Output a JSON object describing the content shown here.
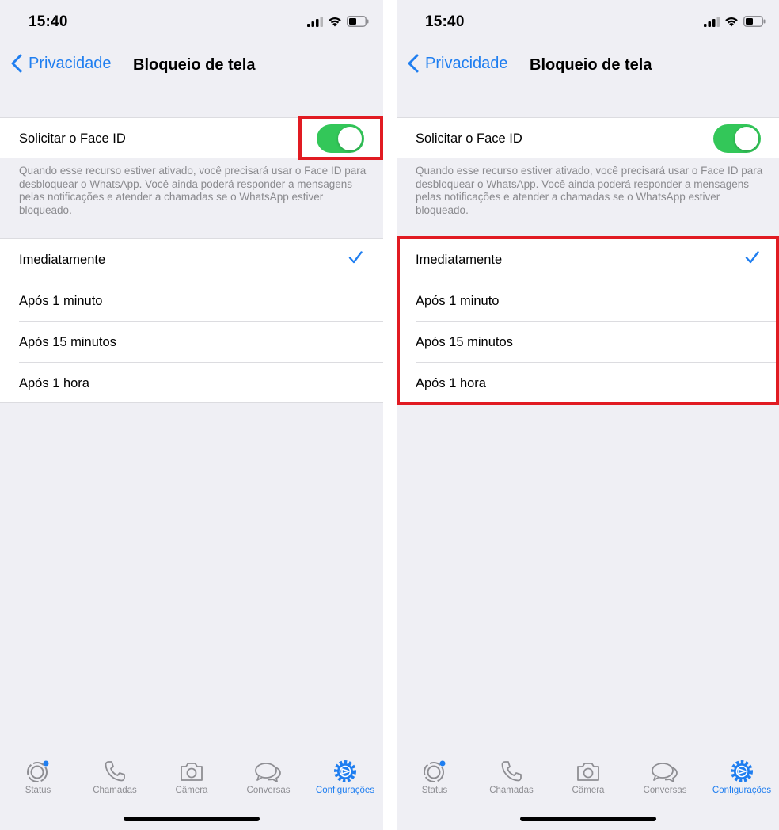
{
  "colors": {
    "accent": "#1f7ef0",
    "toggle_on": "#33c759",
    "highlight": "#e11b22",
    "background": "#efeff4"
  },
  "screens": [
    {
      "status": {
        "time": "15:40"
      },
      "nav": {
        "back_label": "Privacidade",
        "title": "Bloqueio de tela"
      },
      "face_id": {
        "label": "Solicitar o Face ID",
        "enabled": true
      },
      "note": "Quando esse recurso estiver ativado, você precisará usar o Face ID para desbloquear o WhatsApp. Você ainda poderá responder a mensagens pelas notificações e atender a chamadas se o WhatsApp estiver bloqueado.",
      "options": [
        {
          "label": "Imediatamente",
          "selected": true
        },
        {
          "label": "Após 1 minuto",
          "selected": false
        },
        {
          "label": "Após 15 minutos",
          "selected": false
        },
        {
          "label": "Após 1 hora",
          "selected": false
        }
      ],
      "highlight": "face-id-toggle",
      "tabs": [
        {
          "label": "Status",
          "icon": "status-icon",
          "active": false
        },
        {
          "label": "Chamadas",
          "icon": "phone-icon",
          "active": false
        },
        {
          "label": "Câmera",
          "icon": "camera-icon",
          "active": false
        },
        {
          "label": "Conversas",
          "icon": "chat-bubbles-icon",
          "active": false
        },
        {
          "label": "Configurações",
          "icon": "settings-gear-icon",
          "active": true
        }
      ]
    },
    {
      "status": {
        "time": "15:40"
      },
      "nav": {
        "back_label": "Privacidade",
        "title": "Bloqueio de tela"
      },
      "face_id": {
        "label": "Solicitar o Face ID",
        "enabled": true
      },
      "note": "Quando esse recurso estiver ativado, você precisará usar o Face ID para desbloquear o WhatsApp. Você ainda poderá responder a mensagens pelas notificações e atender a chamadas se o WhatsApp estiver bloqueado.",
      "options": [
        {
          "label": "Imediatamente",
          "selected": true
        },
        {
          "label": "Após 1 minuto",
          "selected": false
        },
        {
          "label": "Após 15 minutos",
          "selected": false
        },
        {
          "label": "Após 1 hora",
          "selected": false
        }
      ],
      "highlight": "lock-timing-options",
      "tabs": [
        {
          "label": "Status",
          "icon": "status-icon",
          "active": false
        },
        {
          "label": "Chamadas",
          "icon": "phone-icon",
          "active": false
        },
        {
          "label": "Câmera",
          "icon": "camera-icon",
          "active": false
        },
        {
          "label": "Conversas",
          "icon": "chat-bubbles-icon",
          "active": false
        },
        {
          "label": "Configurações",
          "icon": "settings-gear-icon",
          "active": true
        }
      ]
    }
  ]
}
